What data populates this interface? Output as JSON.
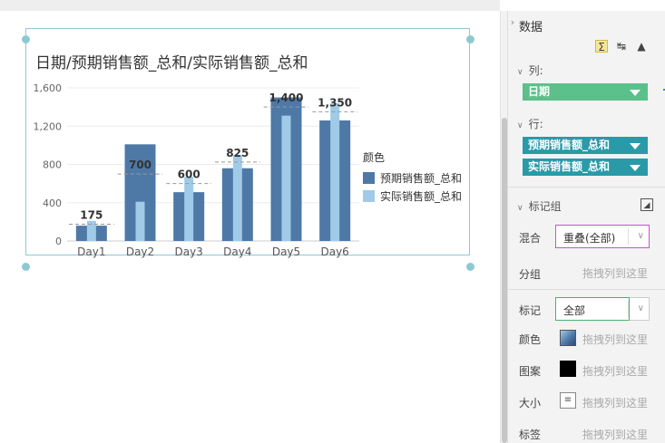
{
  "chart": {
    "title": "日期/预期销售额_总和/实际销售额_总和",
    "legend_title": "颜色",
    "legend": [
      {
        "label": "预期销售额_总和",
        "color": "#4e79a7"
      },
      {
        "label": "实际销售额_总和",
        "color": "#a0cbe8"
      }
    ]
  },
  "chart_data": {
    "type": "bar",
    "title": "日期/预期销售额_总和/实际销售额_总和",
    "categories": [
      "Day1",
      "Day2",
      "Day3",
      "Day4",
      "Day5",
      "Day6"
    ],
    "series": [
      {
        "name": "预期销售额_总和",
        "values": [
          160,
          1010,
          510,
          760,
          1500,
          1260
        ],
        "color": "#4e79a7"
      },
      {
        "name": "实际销售额_总和",
        "values": [
          210,
          410,
          670,
          900,
          1310,
          1440
        ],
        "color": "#a0cbe8"
      }
    ],
    "reference_lines": [
      175,
      700,
      600,
      825,
      1400,
      1350
    ],
    "reference_labels": [
      "175",
      "700",
      "600",
      "825",
      "1,400",
      "1,350"
    ],
    "yticks": [
      0,
      400,
      800,
      1200,
      1600
    ],
    "ytick_labels": [
      "0",
      "400",
      "800",
      "1,200",
      "1,600"
    ],
    "ylim": [
      0,
      1600
    ],
    "xlabel": "",
    "ylabel": "",
    "legend_position": "right",
    "grid": true
  },
  "panel": {
    "title": "数据",
    "tools": [
      "sigma-icon",
      "axis-swap-icon",
      "eraser-icon"
    ],
    "columns_label": "列:",
    "columns_pill": "日期",
    "rows_label": "行:",
    "rows_pills": [
      "预期销售额_总和",
      "实际销售额_总和"
    ],
    "marks_group_label": "标记组",
    "blend_label": "混合",
    "blend_value": "重叠(全部)",
    "group_label": "分组",
    "drop_hint": "拖拽列到这里",
    "mark_label": "标记",
    "mark_value": "全部",
    "color_label": "颜色",
    "pattern_label": "图案",
    "size_label": "大小",
    "tag_label": "标签"
  },
  "colors": {
    "accent_teal": "#2a9aa8",
    "pill_green": "#5cc08a",
    "frame": "#8ec9d2",
    "highlight_purple": "#c94fd8",
    "selected_green": "#4caf6e"
  }
}
